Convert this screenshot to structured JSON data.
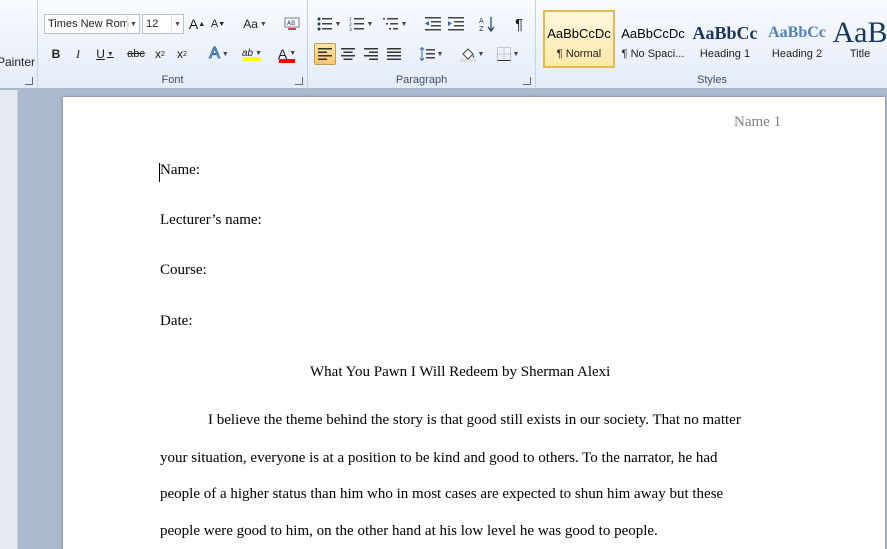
{
  "clipboard": {
    "format_painter_label": "Painter"
  },
  "font_group": {
    "label": "Font",
    "font_name": "Times New Rom",
    "font_size": "12",
    "grow_label": "A",
    "shrink_label": "A",
    "change_case_label": "Aa",
    "bold": "B",
    "italic": "I",
    "underline": "U",
    "strikethrough": "abc",
    "subscript": "x",
    "superscript": "x",
    "text_effects": "A",
    "highlight": "ab",
    "font_color": "A",
    "highlight_color": "#ffff00",
    "font_color_swatch": "#ff0000"
  },
  "paragraph_group": {
    "label": "Paragraph",
    "pilcrow": "¶"
  },
  "styles_group": {
    "label": "Styles",
    "items": [
      {
        "sample": "AaBbCcDc",
        "name": "¶ Normal",
        "selected": true
      },
      {
        "sample": "AaBbCcDc",
        "name": "¶ No Spaci...",
        "selected": false
      },
      {
        "sample": "AaBbCc",
        "name": "Heading 1",
        "selected": false
      },
      {
        "sample": "AaBbCc",
        "name": "Heading 2",
        "selected": false
      },
      {
        "sample": "AaB",
        "name": "Title",
        "selected": false
      }
    ]
  },
  "document": {
    "header": "Name 1",
    "fields": [
      "Name:",
      "Lecturer’s name:",
      "Course:",
      "Date:"
    ],
    "title": "What You Pawn I Will Redeem by Sherman Alexi",
    "body_lines": [
      "I believe the theme behind the story is that good still exists in our society. That no matter",
      "your situation, everyone is at a position to be kind and good to others. To the narrator, he had",
      "people of a higher status than him who in most cases are expected to shun him away but these",
      "people were good to him, on the other hand at his low level he was good to people."
    ]
  }
}
